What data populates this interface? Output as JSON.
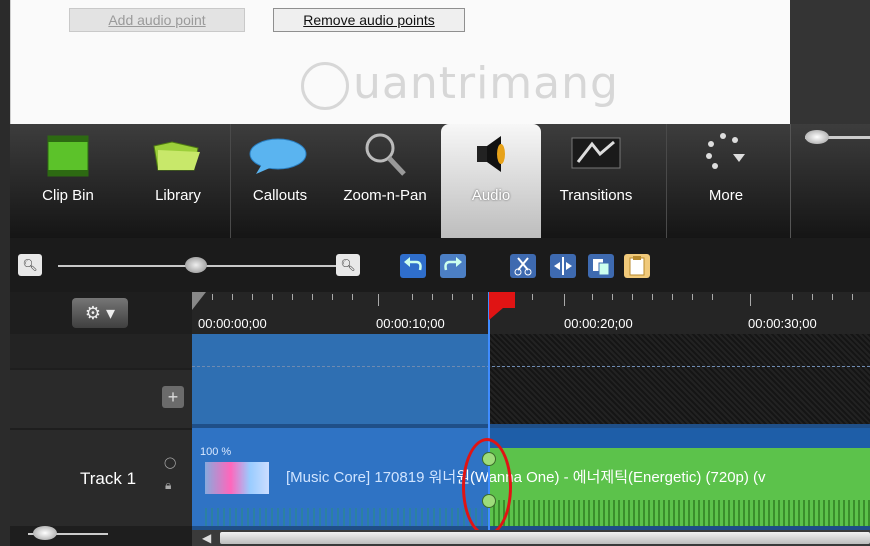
{
  "audio_panel": {
    "add_point_label": "Add audio point",
    "remove_points_label": "Remove audio points"
  },
  "watermark": "uantrimang",
  "toolbar": {
    "tools": [
      {
        "label": "Clip Bin",
        "icon": "film-strip-icon"
      },
      {
        "label": "Library",
        "icon": "folder-icon"
      },
      {
        "label": "Callouts",
        "icon": "speech-bubble-icon"
      },
      {
        "label": "Zoom-n-Pan",
        "icon": "magnifier-icon"
      },
      {
        "label": "Audio",
        "icon": "speaker-icon",
        "active": true
      },
      {
        "label": "Transitions",
        "icon": "transition-icon"
      },
      {
        "label": "More",
        "icon": "more-dots-icon"
      }
    ]
  },
  "timeline": {
    "timecodes": [
      "00:00:00;00",
      "00:00:10;00",
      "00:00:20;00",
      "00:00:30;00"
    ],
    "track_name": "Track 1",
    "volume_label": "100 %",
    "clip_title_part1": "[Music Core] 170819 워너",
    "clip_title_part2": "원(Wanna One) - 에너제틱(Energetic) (720p) (v"
  },
  "colors": {
    "selection": "#2f6fb2",
    "audio_clip": "#5cc24b",
    "playhead": "#e01414"
  }
}
